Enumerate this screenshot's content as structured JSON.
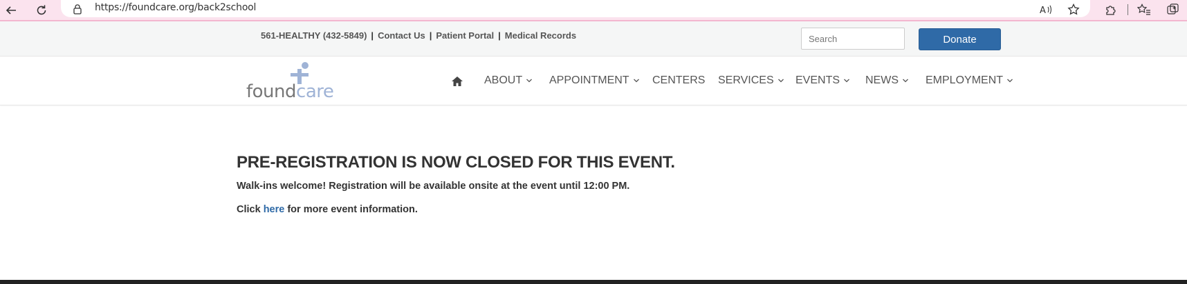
{
  "browser": {
    "url": "https://foundcare.org/back2school",
    "icons": [
      "back-arrow-icon",
      "reload-icon",
      "lock-icon",
      "read-aloud-icon",
      "favorite-star-icon",
      "extensions-icon",
      "favorites-icon",
      "collections-icon"
    ]
  },
  "utility": {
    "phone": "561-HEALTHY (432-5849)",
    "separator": "|",
    "links": [
      "Contact Us",
      "Patient Portal",
      "Medical Records"
    ],
    "search_placeholder": "Search",
    "donate_label": "Donate"
  },
  "logo": {
    "text_part1": "found",
    "text_part2": "care"
  },
  "nav": {
    "items": [
      {
        "label": "ABOUT",
        "has_dropdown": true
      },
      {
        "label": "APPOINTMENT",
        "has_dropdown": true
      },
      {
        "label": "CENTERS",
        "has_dropdown": false
      },
      {
        "label": "SERVICES",
        "has_dropdown": true
      },
      {
        "label": "EVENTS",
        "has_dropdown": true
      },
      {
        "label": "NEWS",
        "has_dropdown": true
      },
      {
        "label": "EMPLOYMENT",
        "has_dropdown": true
      }
    ]
  },
  "content": {
    "title": "PRE-REGISTRATION IS NOW CLOSED FOR THIS EVENT.",
    "line1": "Walk-ins welcome! Registration will be available onsite at the event until 12:00 PM.",
    "line2_prefix": "Click ",
    "line2_link": "here",
    "line2_suffix": " for more event information."
  },
  "colors": {
    "accent": "#2f6aa7",
    "browser_bar": "#fbe3ee",
    "logo_light": "#9fb3d6"
  }
}
